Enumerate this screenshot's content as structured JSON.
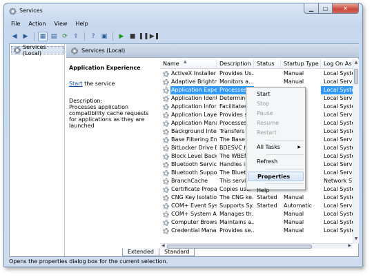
{
  "window": {
    "title": "Services"
  },
  "menu": [
    "File",
    "Action",
    "View",
    "Help"
  ],
  "toolbar": {
    "icons": [
      "back-icon",
      "forward-icon",
      "console-tree-icon",
      "show-hide-icon",
      "refresh-icon",
      "export-icon",
      "help-icon",
      "properties-icon",
      "start-icon",
      "stop-icon",
      "pause-icon",
      "restart-icon"
    ]
  },
  "tree": {
    "root": "Services (Local)"
  },
  "pane": {
    "header": "Services (Local)"
  },
  "description": {
    "service_name": "Application Experience",
    "start_link": "Start",
    "start_suffix": " the service",
    "label": "Description:",
    "text": "Processes application compatibility cache requests for applications as they are launched"
  },
  "columns": [
    "Name",
    "Description",
    "Status",
    "Startup Type",
    "Log On As"
  ],
  "rows": [
    {
      "name": "ActiveX Installer (...",
      "desc": "Provides Us...",
      "status": "",
      "startup": "Manual",
      "logon": "Local Syste..."
    },
    {
      "name": "Adaptive Brightness",
      "desc": "Monitors a...",
      "status": "",
      "startup": "Manual",
      "logon": "Local Service"
    },
    {
      "name": "Application Experi...",
      "desc": "Processes a...",
      "status": "",
      "startup": "",
      "logon": "Local Syste..."
    },
    {
      "name": "Application Identity",
      "desc": "Determines",
      "status": "",
      "startup": "",
      "logon": "Local Service"
    },
    {
      "name": "Application Infor...",
      "desc": "Facilitates t...",
      "status": "",
      "startup": "",
      "logon": "Local Syste..."
    },
    {
      "name": "Application Layer ...",
      "desc": "Provides su...",
      "status": "",
      "startup": "",
      "logon": "Local Service"
    },
    {
      "name": "Application Mana...",
      "desc": "Processes in",
      "status": "",
      "startup": "",
      "logon": "Local Syste..."
    },
    {
      "name": "Background Intelli...",
      "desc": "Transfers fil...",
      "status": "",
      "startup": "",
      "logon": "Local Syste..."
    },
    {
      "name": "Base Filtering Engi...",
      "desc": "The Base Fil...",
      "status": "",
      "startup": "",
      "logon": "Local Service"
    },
    {
      "name": "BitLocker Drive En...",
      "desc": "BDESVC hos...",
      "status": "",
      "startup": "",
      "logon": "Local Syste..."
    },
    {
      "name": "Block Level Backu...",
      "desc": "The WBENG...",
      "status": "",
      "startup": "",
      "logon": "Local Syste..."
    },
    {
      "name": "Bluetooth Service",
      "desc": "Handles in...",
      "status": "",
      "startup": "",
      "logon": "Local Service"
    },
    {
      "name": "Bluetooth Support ...",
      "desc": "The Bluetoo...",
      "status": "",
      "startup": "",
      "logon": "Local Service"
    },
    {
      "name": "BranchCache",
      "desc": "This service",
      "status": "",
      "startup": "",
      "logon": "Network S..."
    },
    {
      "name": "Certificate Propag...",
      "desc": "Copies user",
      "status": "",
      "startup": "",
      "logon": "Local Syste..."
    },
    {
      "name": "CNG Key Isolation",
      "desc": "The CNG ke...",
      "status": "Started",
      "startup": "Manual",
      "logon": "Local Syste..."
    },
    {
      "name": "COM+ Event Syst...",
      "desc": "Supports Sy...",
      "status": "Started",
      "startup": "Automatic",
      "logon": "Local Service"
    },
    {
      "name": "COM+ System Ap...",
      "desc": "Manages th...",
      "status": "",
      "startup": "Manual",
      "logon": "Local Syste..."
    },
    {
      "name": "Computer Browser",
      "desc": "Maintains a...",
      "status": "",
      "startup": "Manual",
      "logon": "Local Syste..."
    },
    {
      "name": "Credential Manager",
      "desc": "Provides se...",
      "status": "",
      "startup": "Manual",
      "logon": "Local Syste..."
    }
  ],
  "context_menu": {
    "items": [
      "Start",
      "Stop",
      "Pause",
      "Resume",
      "Restart",
      "All Tasks",
      "Refresh",
      "Properties",
      "Help"
    ]
  },
  "tabs": [
    "Extended",
    "Standard"
  ],
  "statusbar": "Opens the properties dialog box for the current selection."
}
